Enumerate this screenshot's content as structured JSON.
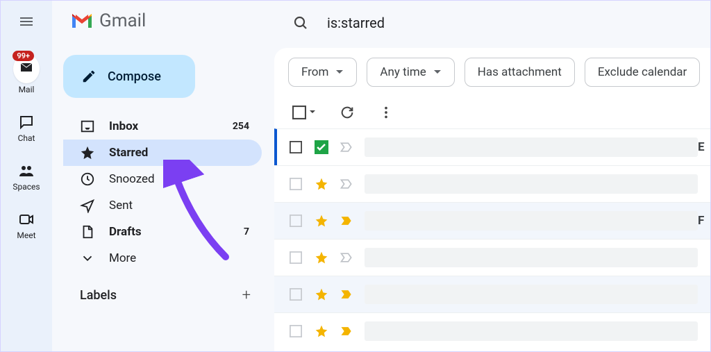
{
  "rail": {
    "mail": {
      "label": "Mail",
      "badge": "99+"
    },
    "chat": {
      "label": "Chat"
    },
    "spaces": {
      "label": "Spaces"
    },
    "meet": {
      "label": "Meet"
    }
  },
  "header": {
    "app_name": "Gmail"
  },
  "compose_label": "Compose",
  "nav": {
    "inbox": {
      "label": "Inbox",
      "count": "254"
    },
    "starred": {
      "label": "Starred"
    },
    "snoozed": {
      "label": "Snoozed"
    },
    "sent": {
      "label": "Sent"
    },
    "drafts": {
      "label": "Drafts",
      "count": "7"
    },
    "more": {
      "label": "More"
    }
  },
  "labels_heading": "Labels",
  "search": {
    "query": "is:starred"
  },
  "chips": {
    "from": "From",
    "any_time": "Any time",
    "has_attachment": "Has attachment",
    "exclude_calendar": "Exclude calendar"
  },
  "rows": [
    {
      "checked": false,
      "star_type": "green-check",
      "importance": "outline",
      "tail": "E"
    },
    {
      "checked": false,
      "star_type": "yellow-star",
      "importance": "outline",
      "tail": ""
    },
    {
      "checked": false,
      "star_type": "yellow-star",
      "importance": "yellow",
      "tail": "F"
    },
    {
      "checked": false,
      "star_type": "yellow-star",
      "importance": "outline",
      "tail": ""
    },
    {
      "checked": false,
      "star_type": "yellow-star",
      "importance": "yellow",
      "tail": ""
    },
    {
      "checked": false,
      "star_type": "yellow-star",
      "importance": "yellow",
      "tail": ""
    }
  ]
}
